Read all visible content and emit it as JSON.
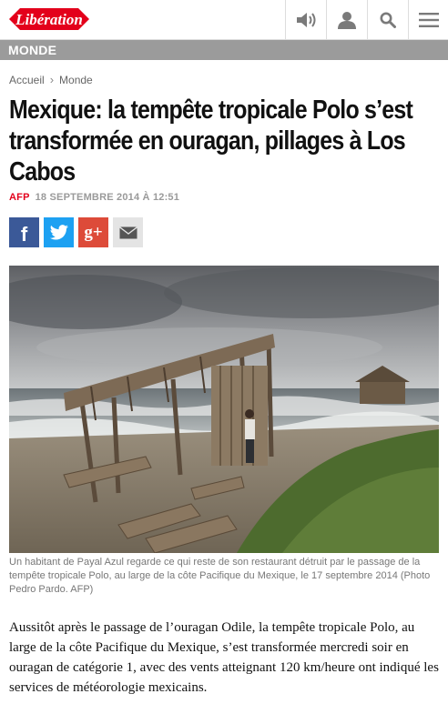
{
  "header": {
    "logo_text": "Libération",
    "icons": [
      "speaker-icon",
      "user-icon",
      "search-icon",
      "menu-icon"
    ]
  },
  "section": {
    "label": "MONDE"
  },
  "breadcrumb": {
    "items": [
      "Accueil",
      "Monde"
    ]
  },
  "article": {
    "title": "Mexique: la tempête tropicale Polo s’est transformée en ouragan, pillages à Los Cabos",
    "source": "AFP",
    "date": "18 SEPTEMBRE 2014 À 12:51",
    "caption": "Un habitant de Payal Azul regarde ce qui reste de son restaurant détruit par le passage de la tempête tropicale Polo, au large de la côte Pacifique du Mexique, le 17 septembre 2014 (Photo Pedro Pardo. AFP)",
    "lead": "Aussitôt après le passage de l’ouragan Odile, la tempête tropicale Polo, au large de la côte Pacifique du Mexique, s’est transformée mercredi soir en ouragan de catégorie 1, avec des vents atteignant 120 km/heure ont indiqué les services de météorologie mexicains."
  },
  "share": {
    "facebook_glyph": "f",
    "googleplus_glyph": "g+"
  },
  "colors": {
    "brand_red": "#e3001b",
    "band_grey": "#9b9b9b",
    "facebook": "#3b5998",
    "twitter": "#1da1f2",
    "googleplus": "#dd4b39"
  }
}
